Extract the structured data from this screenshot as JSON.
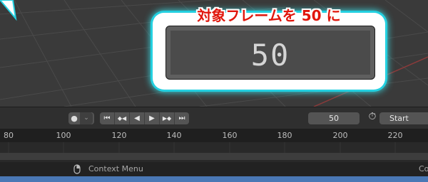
{
  "callout": {
    "title": "対象フレームを 50 に",
    "zoomed_value": "50"
  },
  "header": {
    "record_icon": "●",
    "record_chevron": "⌄",
    "playback_buttons": [
      {
        "name": "jump-to-start-icon",
        "glyph": "⏮"
      },
      {
        "name": "prev-keyframe-icon",
        "glyph": "◆◀"
      },
      {
        "name": "play-reverse-icon",
        "glyph": "◀"
      },
      {
        "name": "play-icon",
        "glyph": "▶"
      },
      {
        "name": "next-keyframe-icon",
        "glyph": "▶◆"
      },
      {
        "name": "jump-to-end-icon",
        "glyph": "⏭"
      }
    ],
    "current_frame": "50",
    "stopwatch_icon": "⏱",
    "start_label": "Start"
  },
  "ruler": {
    "ticks": [
      "80",
      "100",
      "120",
      "140",
      "160",
      "180",
      "200",
      "220"
    ]
  },
  "status_bar": {
    "context_menu": "Context Menu",
    "right_text": "Co"
  },
  "colors": {
    "callout_border": "#23d0e0",
    "callout_title": "#e0160c",
    "status_accent": "#4a78b5"
  }
}
